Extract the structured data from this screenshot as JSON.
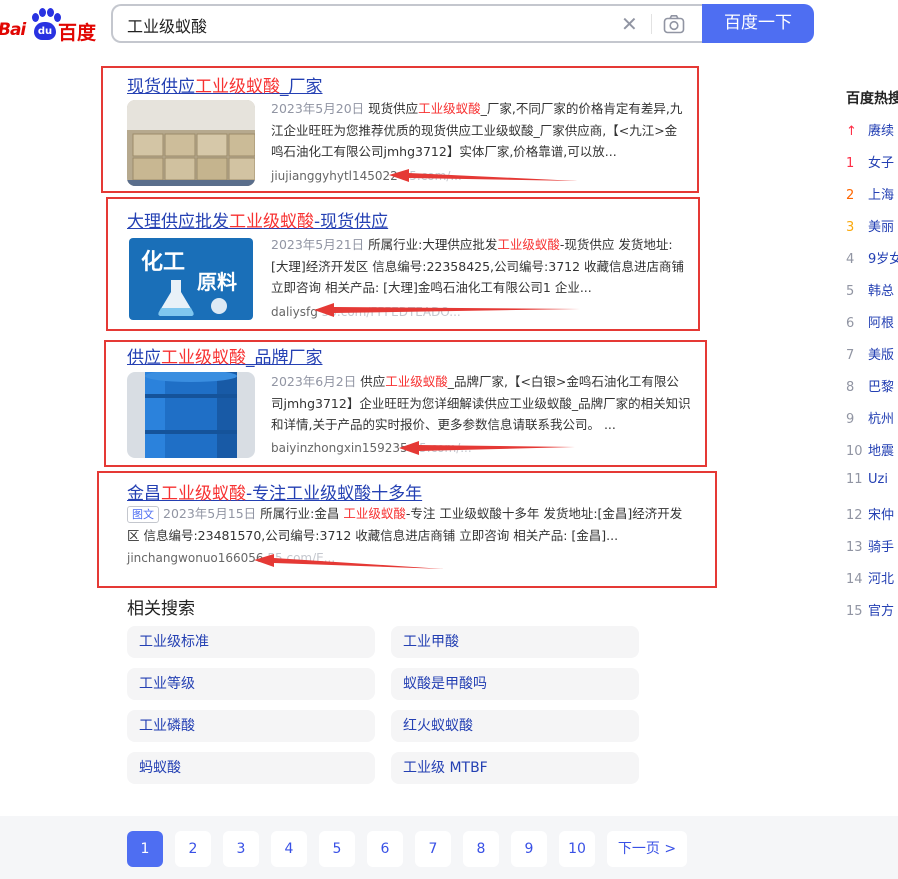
{
  "header": {
    "logo_left": "Bai",
    "logo_paw": "du",
    "logo_right": "百度",
    "search_value": "工业级蚁酸",
    "clear_glyph": "✕",
    "search_button": "百度一下"
  },
  "results": [
    {
      "title_pre": "现货供应",
      "title_hl": "工业级蚁酸",
      "title_post": "_厂家",
      "date": "2023年5月20日",
      "abs_pre": " 现货供应",
      "abs_hl": "工业级蚁酸",
      "abs_post": "_厂家,不同厂家的价格肯定有差异,九江企业旺旺为您推荐优质的现货供应工业级蚁酸_厂家供应商,【<九江>金鸣石油化工有限公司jmhg3712】实体厂家,价格靠谱,可以放...",
      "source": "jiujianggyhytl145022",
      "source_faded": "  55.com/...",
      "thumb": "warehouse"
    },
    {
      "title_pre": "大理供应批发",
      "title_hl": "工业级蚁酸",
      "title_post": "-现货供应",
      "date": "2023年5月21日",
      "abs_pre": " 所属行业:大理供应批发",
      "abs_hl": "工业级蚁酸",
      "abs_post": "-现货供应 发货地址:[大理]经济开发区 信息编号:22358425,公司编号:3712 收藏信息进店商铺 立即咨询 相关产品: [大理]金鸣石油化工有限公司1 企业...",
      "source": "daliysfg",
      "source_faded": "  55.com/FFFEDTEADO...",
      "thumb_top": "化工",
      "thumb_bottom": "原料"
    },
    {
      "title_pre": "供应",
      "title_hl": "工业级蚁酸",
      "title_post": "_品牌厂家",
      "date": "2023年6月2日",
      "abs_pre": " 供应",
      "abs_hl": "工业级蚁酸",
      "abs_post": "_品牌厂家,【<白银>金鸣石油化工有限公司jmhg3712】企业旺旺为您详细解读供应工业级蚁酸_品牌厂家的相关知识和详情,关于产品的实时报价、更多参数信息请联系我公司。 ...",
      "source": "baiyinzhongxin159235",
      "source_faded": "  55.com/...",
      "thumb": "drum"
    },
    {
      "title_pre": "金昌",
      "title_hl": "工业级蚁酸",
      "title_post": "-专注工业级蚁酸十多年",
      "tag": "图文",
      "date": "2023年5月15日",
      "abs_pre": " 所属行业:金昌 ",
      "abs_hl": "工业级蚁酸",
      "abs_post": "-专注 工业级蚁酸十多年 发货地址:[金昌]经济开发区 信息编号:23481570,公司编号:3712 收藏信息进店商铺 立即咨询 相关产品: [金昌]...",
      "source": "jinchangwonuo166056",
      "source_faded": "  55.com/E..."
    }
  ],
  "related": {
    "title": "相关搜索",
    "items": [
      "工业级标准",
      "工业甲酸",
      "工业等级",
      "蚁酸是甲酸吗",
      "工业磷酸",
      "红火蚁蚁酸",
      "蚂蚁酸",
      "工业级 MTBF"
    ]
  },
  "pagination": {
    "pages": [
      "1",
      "2",
      "3",
      "4",
      "5",
      "6",
      "7",
      "8",
      "9",
      "10"
    ],
    "active": "1",
    "next": "下一页 >"
  },
  "hot": {
    "title": "百度热搜",
    "items": [
      {
        "rank": "↑",
        "text": "赓续"
      },
      {
        "rank": "1",
        "text": "女子"
      },
      {
        "rank": "2",
        "text": "上海"
      },
      {
        "rank": "3",
        "text": "美丽"
      },
      {
        "rank": "4",
        "text": "9岁女"
      },
      {
        "rank": "5",
        "text": "韩总"
      },
      {
        "rank": "6",
        "text": "阿根"
      },
      {
        "rank": "7",
        "text": "美版"
      },
      {
        "rank": "8",
        "text": "巴黎"
      },
      {
        "rank": "9",
        "text": "杭州"
      },
      {
        "rank": "10",
        "text": "地震"
      },
      {
        "rank": "11",
        "text": "Uzi"
      },
      {
        "rank": "12",
        "text": "宋仲"
      },
      {
        "rank": "13",
        "text": "骑手"
      },
      {
        "rank": "14",
        "text": "河北"
      },
      {
        "rank": "15",
        "text": "官方"
      }
    ]
  },
  "colors": {
    "brand_blue": "#4e6ef2",
    "link_blue": "#2440b3",
    "highlight_red": "#f73131",
    "annotation_red": "#e53935"
  }
}
